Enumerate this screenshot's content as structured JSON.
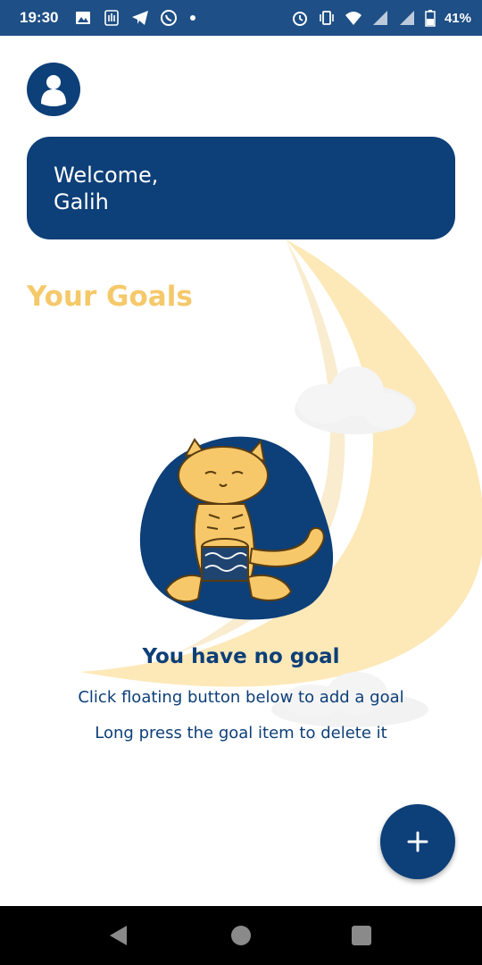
{
  "status_bar": {
    "time": "19:30",
    "battery_percent": "41%",
    "icons_left": [
      "image-icon",
      "hand-icon",
      "telegram-icon",
      "whatsapp-icon",
      "dot-icon"
    ],
    "icons_right": [
      "alarm-icon",
      "vibrate-icon",
      "wifi-icon",
      "signal-icon",
      "signal-icon",
      "battery-icon"
    ],
    "bg_color": "#1e4f86"
  },
  "profile": {
    "icon": "user-icon"
  },
  "welcome": {
    "line1": "Welcome,",
    "line2": "Galih"
  },
  "goals": {
    "section_title": "Your Goals"
  },
  "empty_state": {
    "title": "You have no goal",
    "hint_add": "Click floating button below to add a goal",
    "hint_delete": "Long press the goal item to delete it"
  },
  "fab": {
    "icon": "plus-icon"
  },
  "nav_bar": {
    "back_icon": "back-triangle-icon",
    "home_icon": "home-circle-icon",
    "recents_icon": "recents-square-icon"
  },
  "colors": {
    "primary": "#0d3f78",
    "accent": "#f5c96a",
    "moon": "#fde8b8",
    "background": "#ffffff"
  }
}
